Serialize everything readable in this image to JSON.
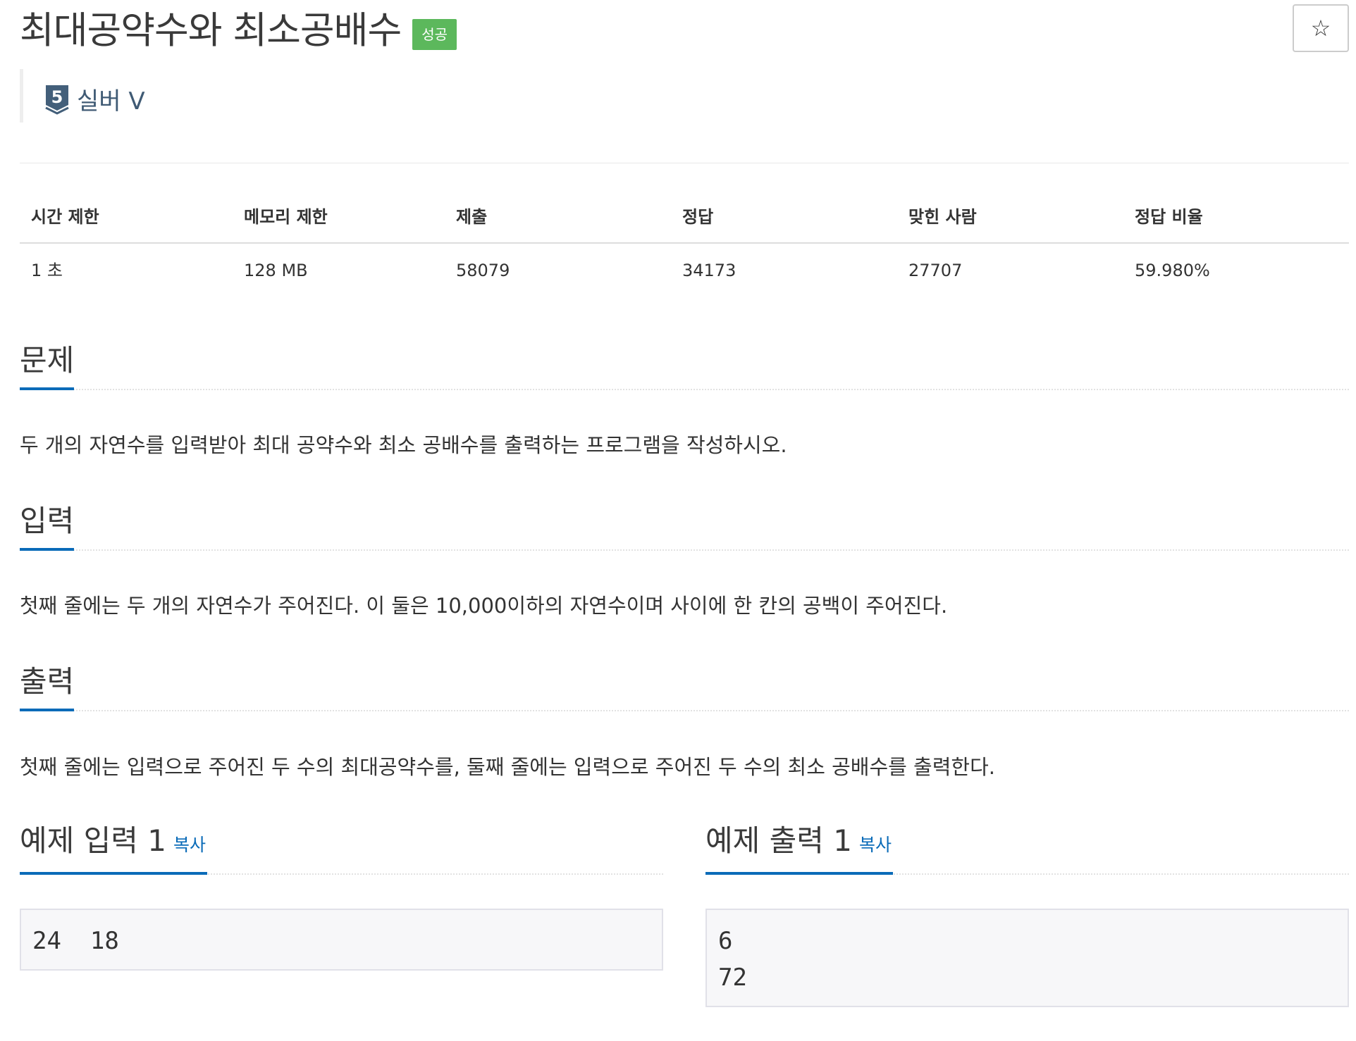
{
  "problem": {
    "title": "최대공약수와 최소공배수",
    "status_badge": "성공",
    "star_symbol": "☆",
    "tier": {
      "number": "5",
      "label": "실버 V",
      "color": "#435f7a"
    }
  },
  "stats": {
    "headers": [
      "시간 제한",
      "메모리 제한",
      "제출",
      "정답",
      "맞힌 사람",
      "정답 비율"
    ],
    "values": [
      "1 초",
      "128 MB",
      "58079",
      "34173",
      "27707",
      "59.980%"
    ]
  },
  "sections": {
    "problem": {
      "title": "문제",
      "text": "두 개의 자연수를 입력받아 최대 공약수와 최소 공배수를 출력하는 프로그램을 작성하시오."
    },
    "input": {
      "title": "입력",
      "text": "첫째 줄에는 두 개의 자연수가 주어진다. 이 둘은 10,000이하의 자연수이며 사이에 한 칸의 공백이 주어진다."
    },
    "output": {
      "title": "출력",
      "text": "첫째 줄에는 입력으로 주어진 두 수의 최대공약수를, 둘째 줄에는 입력으로 주어진 두 수의 최소 공배수를 출력한다."
    }
  },
  "samples": {
    "input": {
      "title": "예제 입력 1",
      "copy_label": "복사",
      "content": "24  18"
    },
    "output": {
      "title": "예제 출력 1",
      "copy_label": "복사",
      "content": "6\n72"
    }
  },
  "colors": {
    "accent": "#0a6bb8",
    "success": "#5cb85c"
  }
}
